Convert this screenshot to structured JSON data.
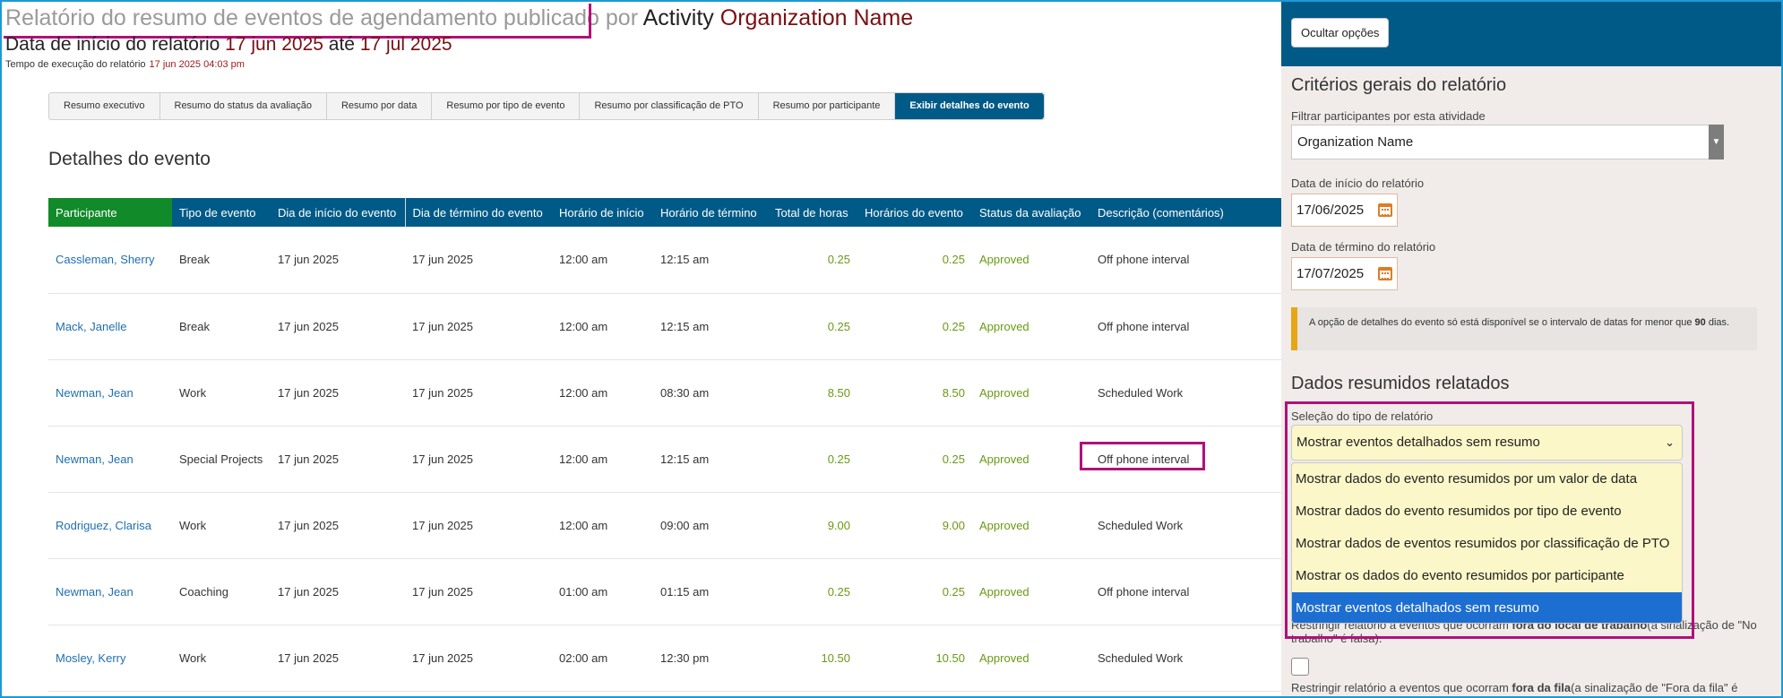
{
  "header": {
    "title_prefix": "Relatório do resumo de eventos de agendamento publicado por",
    "title_activity": "Activity",
    "title_org": "Organization Name",
    "date_prefix": "Data de início do relatório",
    "date_start": "17 jun 2025",
    "date_connector": "até",
    "date_end": "17 jul 2025",
    "exec_label": "Tempo de execução do relatório",
    "exec_value": "17 jun 2025 04:03 pm"
  },
  "tabs": [
    {
      "label": "Resumo executivo"
    },
    {
      "label": "Resumo do status da avaliação"
    },
    {
      "label": "Resumo por data"
    },
    {
      "label": "Resumo por tipo de evento"
    },
    {
      "label": "Resumo por classificação de PTO"
    },
    {
      "label": "Resumo por participante"
    },
    {
      "label": "Exibir detalhes do evento",
      "active": true
    }
  ],
  "section_title": "Detalhes do evento",
  "table": {
    "columns": [
      "Participante",
      "Tipo de evento",
      "Dia de início do evento",
      "Dia de término do evento",
      "Horário de início",
      "Horário de término",
      "Total de horas",
      "Horários do evento",
      "Status da avaliação",
      "Descrição (comentários)"
    ],
    "rows": [
      [
        "Cassleman, Sherry",
        "Break",
        "17 jun 2025",
        "17 jun 2025",
        "12:00 am",
        "12:15 am",
        "0.25",
        "0.25",
        "Approved",
        "Off phone interval"
      ],
      [
        "Mack, Janelle",
        "Break",
        "17 jun 2025",
        "17 jun 2025",
        "12:00 am",
        "12:15 am",
        "0.25",
        "0.25",
        "Approved",
        "Off phone interval"
      ],
      [
        "Newman, Jean",
        "Work",
        "17 jun 2025",
        "17 jun 2025",
        "12:00 am",
        "08:30 am",
        "8.50",
        "8.50",
        "Approved",
        "Scheduled Work"
      ],
      [
        "Newman, Jean",
        "Special Projects",
        "17 jun 2025",
        "17 jun 2025",
        "12:00 am",
        "12:15 am",
        "0.25",
        "0.25",
        "Approved",
        "Off phone interval"
      ],
      [
        "Rodriguez, Clarisa",
        "Work",
        "17 jun 2025",
        "17 jun 2025",
        "12:00 am",
        "09:00 am",
        "9.00",
        "9.00",
        "Approved",
        "Scheduled Work"
      ],
      [
        "Newman, Jean",
        "Coaching",
        "17 jun 2025",
        "17 jun 2025",
        "01:00 am",
        "01:15 am",
        "0.25",
        "0.25",
        "Approved",
        "Off phone interval"
      ],
      [
        "Mosley, Kerry",
        "Work",
        "17 jun 2025",
        "17 jun 2025",
        "02:00 am",
        "12:30 pm",
        "10.50",
        "10.50",
        "Approved",
        "Scheduled Work"
      ]
    ]
  },
  "panel": {
    "hide_button": "Ocultar opções",
    "criteria_title": "Critérios gerais do relatório",
    "filter_label": "Filtrar participantes por esta atividade",
    "filter_value": "Organization Name",
    "start_label": "Data de início do relatório",
    "start_value": "17/06/2025",
    "end_label": "Data de término do relatório",
    "end_value": "17/07/2025",
    "notice_text": "A opção de detalhes do evento só está disponível se o intervalo de datas for menor que",
    "notice_bold": "90",
    "notice_suffix": "dias.",
    "summary_title": "Dados resumidos relatados",
    "type_label": "Seleção do tipo de relatório",
    "type_value": "Mostrar eventos detalhados sem resumo",
    "options": [
      "Mostrar dados do evento resumidos por um valor de data",
      "Mostrar dados do evento resumidos por tipo de evento",
      "Mostrar dados de eventos resumidos por classificação de PTO",
      "Mostrar os dados do evento resumidos por participante",
      "Mostrar eventos detalhados sem resumo"
    ],
    "selected_option_index": 4,
    "restrict1_pre": "Restringir relatório a eventos que ocorram",
    "restrict1_bold": "fora do local de trabalho",
    "restrict1_post": "(a sinalização de \"No trabalho\" é falsa).",
    "restrict2_pre": "Restringir relatório a eventos que ocorram",
    "restrict2_bold": "fora da fila",
    "restrict2_post": "(a sinalização de \"Fora da fila\" é"
  },
  "colors": {
    "header_blue": "#005a87",
    "participant_green": "#118a2a",
    "highlight_magenta": "#b0117a",
    "approved_green": "#6a9a14",
    "link_blue": "#1f6fb0",
    "org_red": "#7a0f12"
  },
  "icons": [
    "calendar-icon",
    "chevron-down-icon",
    "caret-down-icon"
  ]
}
